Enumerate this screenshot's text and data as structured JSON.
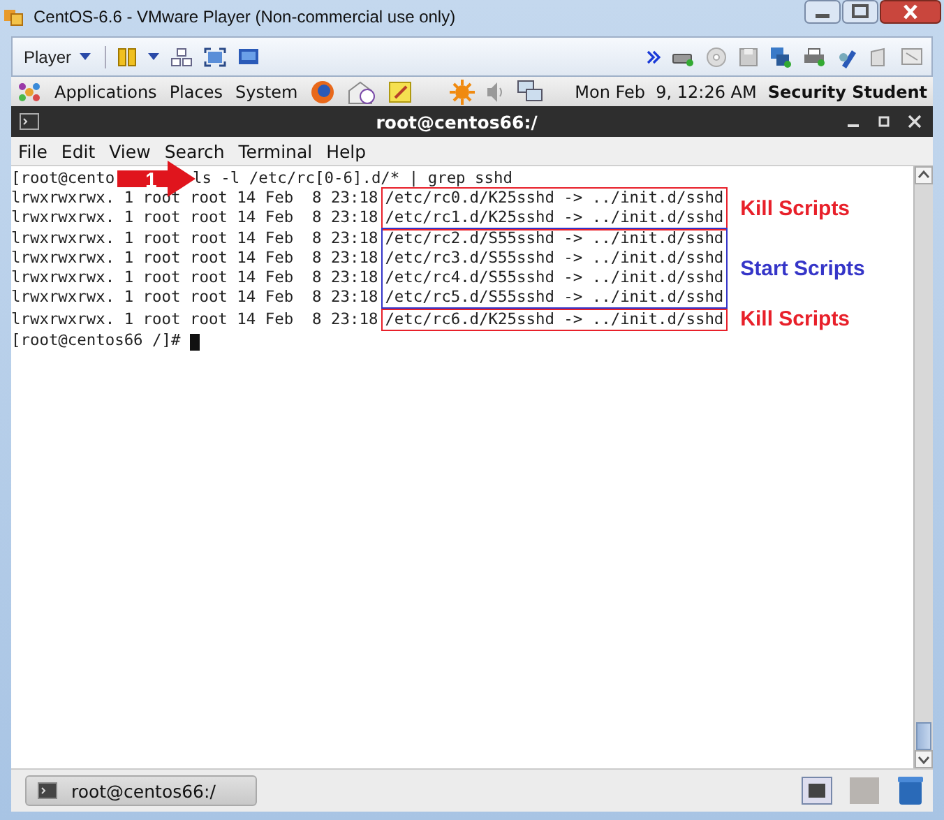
{
  "window": {
    "title": "CentOS-6.6 - VMware Player (Non-commercial use only)"
  },
  "player_toolbar": {
    "menu": "Player"
  },
  "gnome_panel": {
    "menus": [
      "Applications",
      "Places",
      "System"
    ],
    "clock": "Mon Feb  9, 12:26 AM",
    "user": "Security Student"
  },
  "terminal": {
    "title": "root@centos66:/",
    "menu": [
      "File",
      "Edit",
      "View",
      "Search",
      "Terminal",
      "Help"
    ],
    "command_line": {
      "prompt_visible": "[root@cento",
      "command": "ls -l /etc/rc[0-6].d/* | grep sshd"
    },
    "output_groups": [
      {
        "label": "Kill Scripts",
        "color": "#e8202a",
        "lines": [
          {
            "info": "lrwxrwxrwx. 1 root root 14 Feb  8 23:18",
            "path": "/etc/rc0.d/K25sshd -> ../init.d/sshd"
          },
          {
            "info": "lrwxrwxrwx. 1 root root 14 Feb  8 23:18",
            "path": "/etc/rc1.d/K25sshd -> ../init.d/sshd"
          }
        ]
      },
      {
        "label": "Start Scripts",
        "color": "#3535c8",
        "lines": [
          {
            "info": "lrwxrwxrwx. 1 root root 14 Feb  8 23:18",
            "path": "/etc/rc2.d/S55sshd -> ../init.d/sshd"
          },
          {
            "info": "lrwxrwxrwx. 1 root root 14 Feb  8 23:18",
            "path": "/etc/rc3.d/S55sshd -> ../init.d/sshd"
          },
          {
            "info": "lrwxrwxrwx. 1 root root 14 Feb  8 23:18",
            "path": "/etc/rc4.d/S55sshd -> ../init.d/sshd"
          },
          {
            "info": "lrwxrwxrwx. 1 root root 14 Feb  8 23:18",
            "path": "/etc/rc5.d/S55sshd -> ../init.d/sshd"
          }
        ]
      },
      {
        "label": "Kill Scripts",
        "color": "#e8202a",
        "lines": [
          {
            "info": "lrwxrwxrwx. 1 root root 14 Feb  8 23:18",
            "path": "/etc/rc6.d/K25sshd -> ../init.d/sshd"
          }
        ]
      }
    ],
    "final_prompt": "[root@centos66 /]#"
  },
  "callout": {
    "number": "1"
  },
  "taskbar": {
    "items": [
      {
        "label": "root@centos66:/"
      }
    ]
  }
}
